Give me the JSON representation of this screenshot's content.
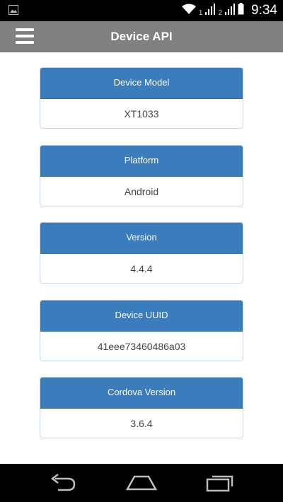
{
  "status_bar": {
    "notification_icon": "image-icon",
    "sim1_label": "1",
    "sim2_label": "2",
    "time": "9:34"
  },
  "app_bar": {
    "menu_icon": "hamburger-icon",
    "title": "Device API"
  },
  "cards": [
    {
      "label": "Device Model",
      "value": "XT1033"
    },
    {
      "label": "Platform",
      "value": "Android"
    },
    {
      "label": "Version",
      "value": "4.4.4"
    },
    {
      "label": "Device UUID",
      "value": "41eee73460486a03"
    },
    {
      "label": "Cordova Version",
      "value": "3.6.4"
    }
  ],
  "nav_bar": {
    "back_icon": "back-icon",
    "home_icon": "home-icon",
    "recents_icon": "recents-icon"
  },
  "colors": {
    "app_bar": "#808080",
    "card_header": "#3a7cbc",
    "status_bar": "#000000"
  }
}
